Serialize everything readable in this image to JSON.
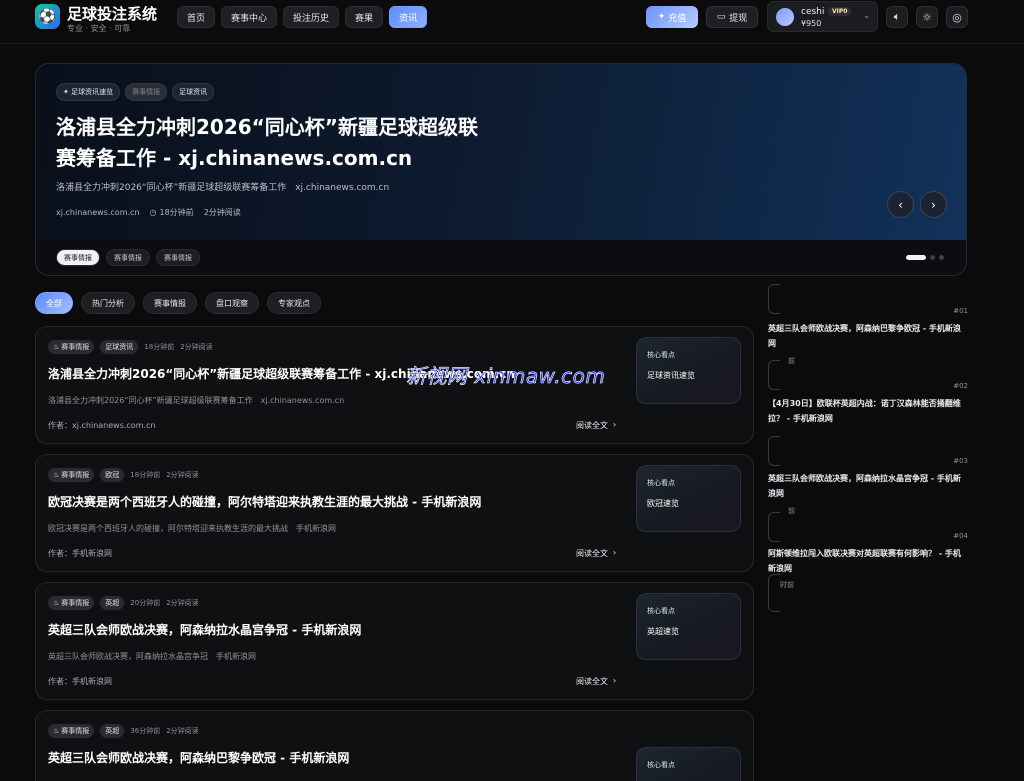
{
  "header": {
    "logo_icon": "soccer-ball-icon",
    "brand_title": "足球投注系统",
    "brand_sub": "专业 · 安全 · 可靠",
    "nav": [
      {
        "label": "首页",
        "active": false
      },
      {
        "label": "赛事中心",
        "active": false
      },
      {
        "label": "投注历史",
        "active": false
      },
      {
        "label": "赛果",
        "active": false
      },
      {
        "label": "资讯",
        "active": true
      }
    ],
    "recharge_label": "充值",
    "withdraw_label": "提现",
    "user": {
      "name": "ceshi",
      "vip": "VIP0",
      "balance": "¥950"
    },
    "icons": [
      "volume-icon",
      "sun-icon",
      "globe-icon"
    ]
  },
  "hero": {
    "tags": [
      "足球资讯速览",
      "赛事情报",
      "足球资讯"
    ],
    "title": "洛浦县全力冲刺2026“同心杯”新疆足球超级联赛筹备工作 - xj.chinanews.com.cn",
    "summary": "洛浦县全力冲刺2026“同心杯”新疆足球超级联赛筹备工作　xj.chinanews.com.cn",
    "source": "xj.chinanews.com.cn",
    "time": "18分钟前",
    "read_time": "2分钟阅读",
    "thumbs": [
      "赛事情报",
      "赛事情报",
      "赛事情报"
    ]
  },
  "filters": [
    {
      "label": "全部",
      "active": true
    },
    {
      "label": "热门分析",
      "active": false
    },
    {
      "label": "赛事情报",
      "active": false
    },
    {
      "label": "盘口观察",
      "active": false
    },
    {
      "label": "专家观点",
      "active": false
    }
  ],
  "articles": [
    {
      "tag": "赛事情报",
      "category": "足球资讯",
      "time": "18分钟前",
      "read": "2分钟阅读",
      "title": "洛浦县全力冲刺2026“同心杯”新疆足球超级联赛筹备工作 - xj.chinanews.com.cn",
      "summary": "洛浦县全力冲刺2026“同心杯”新疆足球超级联赛筹备工作　xj.chinanews.com.cn",
      "author": "作者：xj.chinanews.com.cn",
      "read_more": "阅读全文",
      "key_label": "核心看点",
      "key_value": "足球资讯速览"
    },
    {
      "tag": "赛事情报",
      "category": "欧冠",
      "time": "18分钟前",
      "read": "2分钟阅读",
      "title": "欧冠决赛是两个西班牙人的碰撞，阿尔特塔迎来执教生涯的最大挑战 - 手机新浪网",
      "summary": "欧冠决赛是两个西班牙人的碰撞，阿尔特塔迎来执教生涯的最大挑战　手机新浪网",
      "author": "作者：手机新浪网",
      "read_more": "阅读全文",
      "key_label": "核心看点",
      "key_value": "欧冠速览"
    },
    {
      "tag": "赛事情报",
      "category": "英超",
      "time": "20分钟前",
      "read": "2分钟阅读",
      "title": "英超三队会师欧战决赛，阿森纳拉水晶宫争冠 - 手机新浪网",
      "summary": "英超三队会师欧战决赛，阿森纳拉水晶宫争冠　手机新浪网",
      "author": "作者：手机新浪网",
      "read_more": "阅读全文",
      "key_label": "核心看点",
      "key_value": "英超速览"
    },
    {
      "tag": "赛事情报",
      "category": "英超",
      "time": "36分钟前",
      "read": "2分钟阅读",
      "title": "英超三队会师欧战决赛，阿森纳巴黎争欧冠 - 手机新浪网",
      "summary": "",
      "author": "",
      "read_more": "",
      "key_label": "核心看点",
      "key_value": ""
    }
  ],
  "watermark": "新视网 xinmaw.com",
  "ranking": [
    {
      "num": "#01",
      "title": "英超三队会师欧战决赛，阿森纳巴黎争欧冠 - 手机新浪网",
      "time": "前"
    },
    {
      "num": "#02",
      "title": "【4月30日】欧联杯英超内战：诺丁汉森林能否捅翻维拉？ - 手机新浪网",
      "time": ""
    },
    {
      "num": "#03",
      "title": "英超三队会师欧战决赛，阿森纳拉水晶宫争冠 - 手机新浪网",
      "time": "前"
    },
    {
      "num": "#04",
      "title": "阿斯顿维拉闯入欧联决赛对英超联赛有何影响？ - 手机新浪网",
      "time": "时前"
    }
  ]
}
